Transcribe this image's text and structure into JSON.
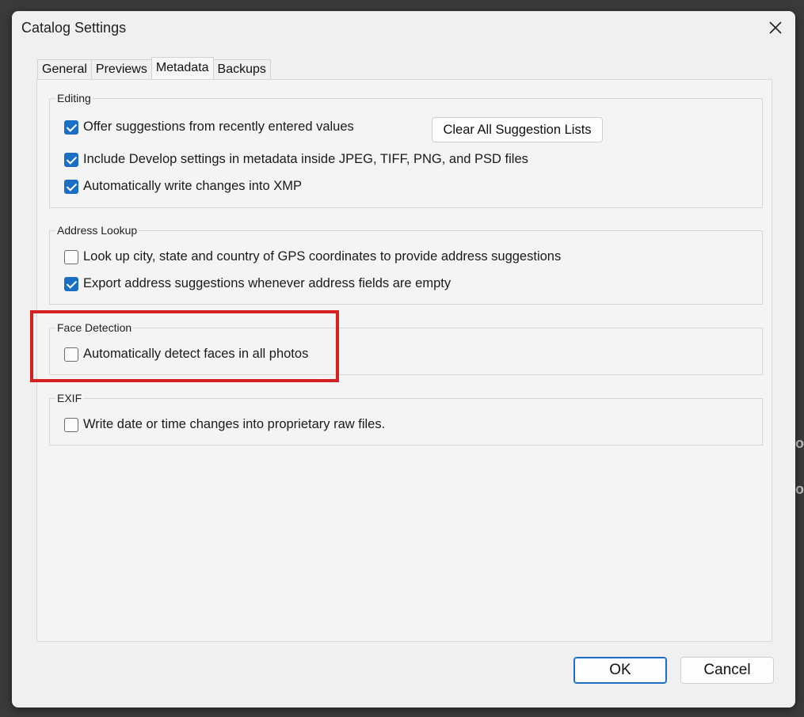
{
  "window": {
    "title": "Catalog Settings",
    "close_icon": "close-icon"
  },
  "tabs": [
    {
      "label": "General",
      "active": false
    },
    {
      "label": "Previews",
      "active": false
    },
    {
      "label": "Metadata",
      "active": true
    },
    {
      "label": "Backups",
      "active": false
    }
  ],
  "groups": {
    "editing": {
      "label": "Editing",
      "items": [
        {
          "label": "Offer suggestions from recently entered values",
          "checked": true
        },
        {
          "label": "Include Develop settings in metadata inside JPEG, TIFF, PNG, and PSD files",
          "checked": true
        },
        {
          "label": "Automatically write changes into XMP",
          "checked": true
        }
      ],
      "clear_button": "Clear All Suggestion Lists"
    },
    "address_lookup": {
      "label": "Address Lookup",
      "items": [
        {
          "label": "Look up city, state and country of GPS coordinates to provide address suggestions",
          "checked": false
        },
        {
          "label": "Export address suggestions whenever address fields are empty",
          "checked": true
        }
      ]
    },
    "face_detection": {
      "label": "Face Detection",
      "items": [
        {
          "label": "Automatically detect faces in all photos",
          "checked": false
        }
      ]
    },
    "exif": {
      "label": "EXIF",
      "items": [
        {
          "label": "Write date or time changes into proprietary raw files.",
          "checked": false
        }
      ]
    }
  },
  "footer": {
    "ok_label": "OK",
    "cancel_label": "Cancel"
  },
  "colors": {
    "accent": "#1a6fc4",
    "highlight": "#d42020"
  }
}
